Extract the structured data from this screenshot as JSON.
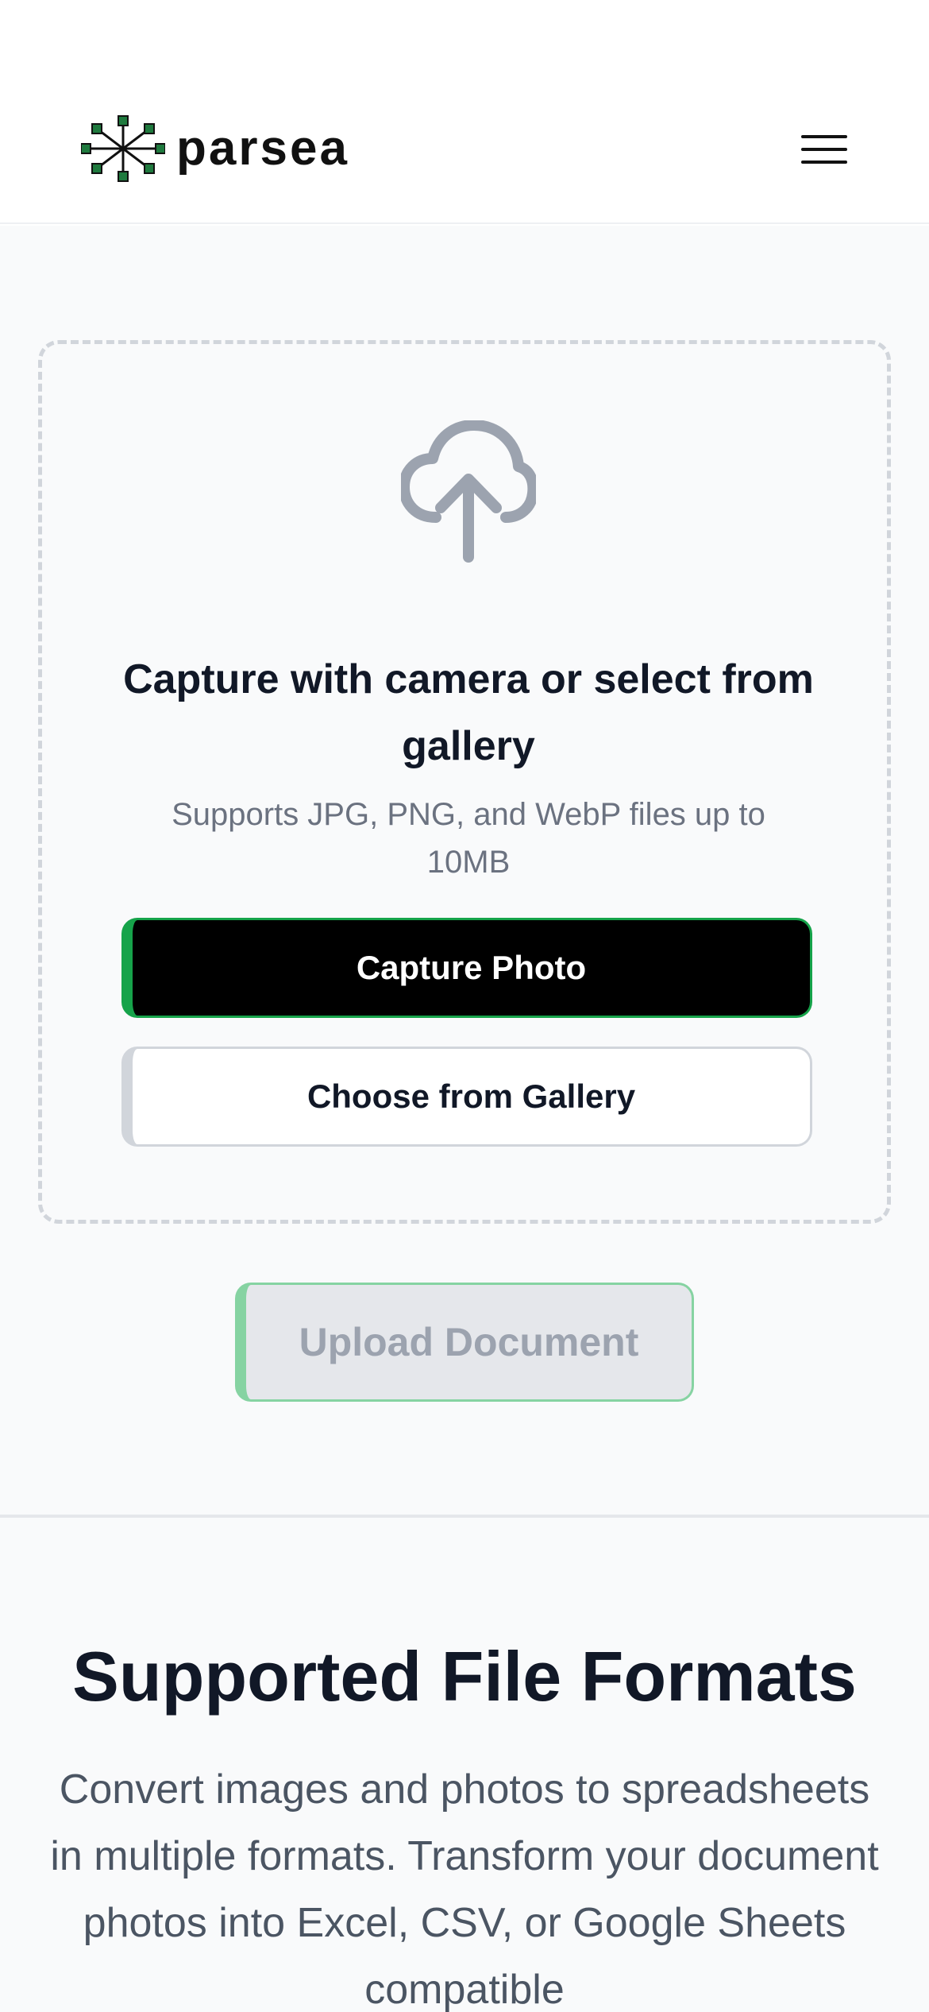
{
  "header": {
    "brand_name": "parsea",
    "logo_icon": "network-node-logo",
    "menu_icon": "hamburger-menu-icon"
  },
  "upload": {
    "icon": "cloud-upload-icon",
    "title": "Capture with camera or select from gallery",
    "subtitle": "Supports JPG, PNG, and WebP files up to 10MB",
    "capture_button": "Capture Photo",
    "gallery_button": "Choose from Gallery",
    "upload_button": "Upload Document"
  },
  "formats": {
    "title": "Supported File Formats",
    "description": "Convert images and photos to spreadsheets in multiple formats. Transform your document photos into Excel, CSV, or Google Sheets compatible"
  },
  "colors": {
    "accent_green": "#16a34a",
    "logo_node_green": "#1f7a3e",
    "text_dark": "#111827",
    "text_muted": "#6b7280",
    "disabled_bg": "#e5e7eb",
    "page_bg_gray": "#f9fafb"
  }
}
